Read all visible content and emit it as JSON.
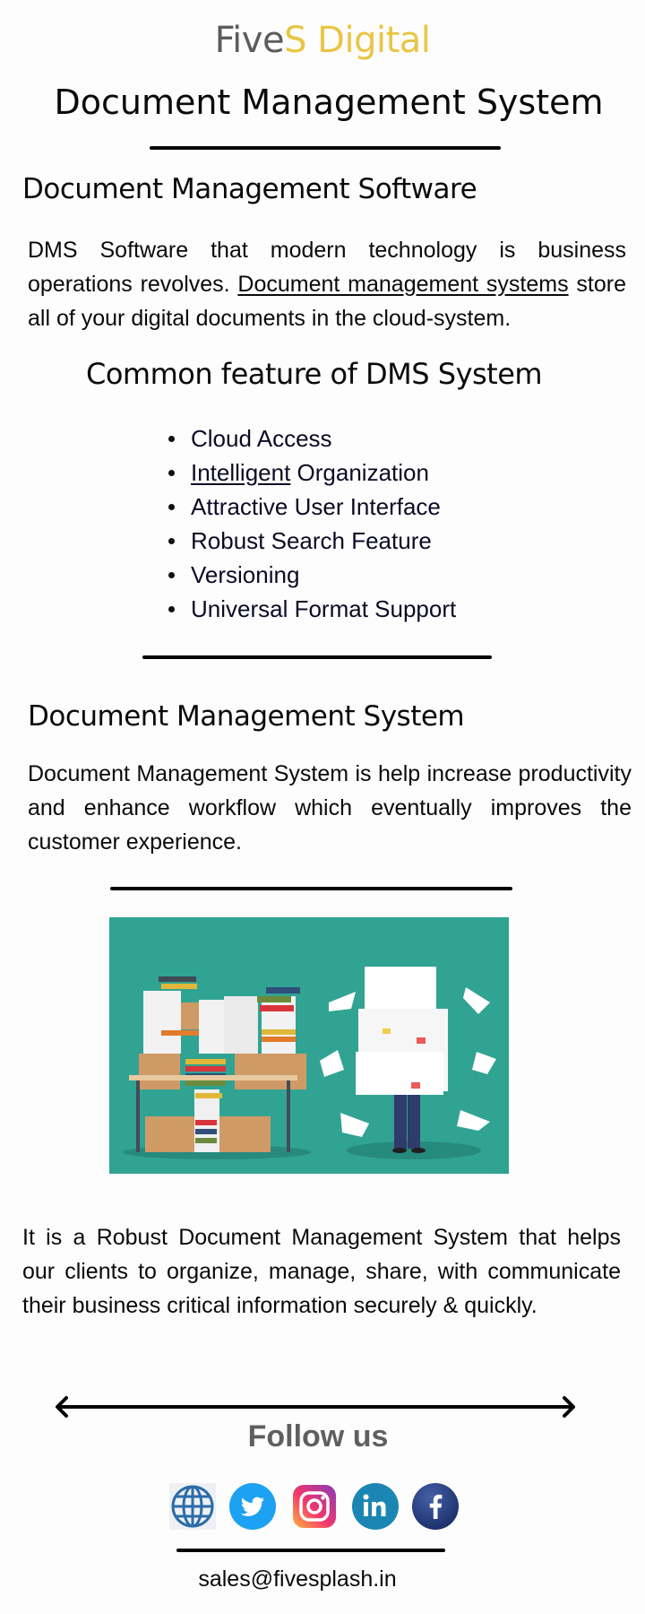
{
  "brand": {
    "part1": "Five",
    "part2": "S Digital",
    "color_primary": "#5c5c5c",
    "color_accent": "#e9c544"
  },
  "header": {
    "title": "Document Management System"
  },
  "section1": {
    "heading": "Document Management Software",
    "text_before_link": "DMS Software that modern technology is business operations revolves. ",
    "link_text": "Document management systems",
    "text_after_link": " store all of your digital documents in the cloud-system."
  },
  "features": {
    "heading": "Common feature of DMS System",
    "items": [
      {
        "label": "Cloud Access"
      },
      {
        "underlined": "Intelligent",
        "label": " Organization"
      },
      {
        "label": "Attractive User Interface"
      },
      {
        "label": "Robust Search Feature"
      },
      {
        "label": "Versioning"
      },
      {
        "label": "Universal Format Support"
      }
    ]
  },
  "section2": {
    "heading": "Document Management System",
    "text": "Document Management System is help increase productivity and enhance workflow which eventually improves the customer experience."
  },
  "illustration": {
    "alt": "Office desk piled with binders, boxes and papers beside a person carrying a tall stack of documents",
    "background": "#31a393"
  },
  "section3": {
    "text": "It is a Robust Document Management System that helps our clients to organize, manage, share, with communicate their business critical information securely & quickly."
  },
  "footer": {
    "follow_label": "Follow us",
    "social": [
      {
        "name": "website",
        "icon": "globe-icon",
        "color": "#2b6ca8"
      },
      {
        "name": "twitter",
        "icon": "twitter-icon",
        "color": "#1da1f2"
      },
      {
        "name": "instagram",
        "icon": "instagram-icon",
        "color": "#e1306c"
      },
      {
        "name": "linkedin",
        "icon": "linkedin-icon",
        "color": "#1b86b4"
      },
      {
        "name": "facebook",
        "icon": "facebook-icon",
        "color": "#24397a"
      }
    ],
    "email": "sales@fivesplash.in"
  }
}
